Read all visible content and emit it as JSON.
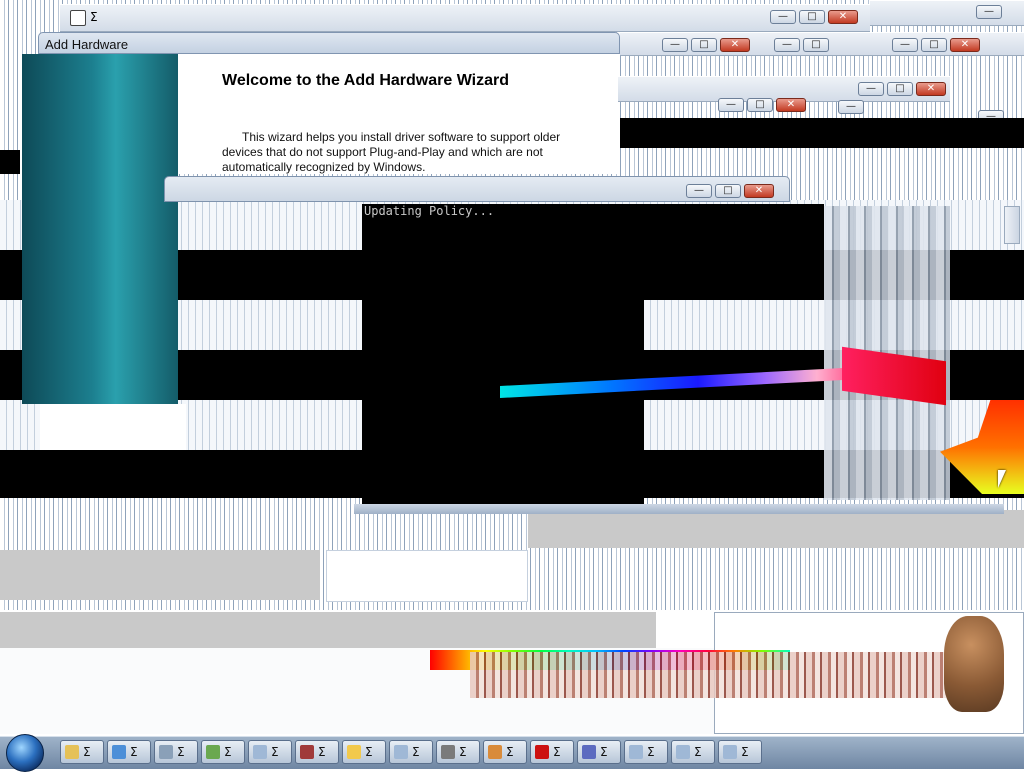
{
  "background_windows": {
    "sigma_label": "Σ"
  },
  "wizard": {
    "title": "Add Hardware",
    "heading": "Welcome to the Add Hardware Wizard",
    "body_line1": "This wizard helps you install driver software to support older",
    "body_line2": "devices that do not support Plug-and-Play and which are not",
    "body_line3": "automatically recognized by Windows."
  },
  "console": {
    "text": "Updating Policy..."
  },
  "window_buttons": {
    "minimize": "—",
    "maximize": "□",
    "close": "✕"
  },
  "taskbar": {
    "items": [
      {
        "label": "Σ",
        "icon": "folder-icon"
      },
      {
        "label": "Σ",
        "icon": "control-panel-icon"
      },
      {
        "label": "Σ",
        "icon": "gears-icon"
      },
      {
        "label": "Σ",
        "icon": "hardware-icon"
      },
      {
        "label": "Σ",
        "icon": "window-icon"
      },
      {
        "label": "Σ",
        "icon": "user-icon"
      },
      {
        "label": "Σ",
        "icon": "x-badge-icon"
      },
      {
        "label": "Σ",
        "icon": "window-icon"
      },
      {
        "label": "Σ",
        "icon": "paint-icon"
      },
      {
        "label": "Σ",
        "icon": "document-icon"
      },
      {
        "label": "Σ",
        "icon": "flash-icon"
      },
      {
        "label": "Σ",
        "icon": "font-icon"
      },
      {
        "label": "Σ",
        "icon": "window-icon"
      },
      {
        "label": "Σ",
        "icon": "window-icon"
      },
      {
        "label": "Σ",
        "icon": "window-icon"
      }
    ]
  },
  "colors": {
    "accent": "#2b6fbf",
    "console_bg": "#000000",
    "close_red": "#c23a22",
    "wizard_teal": "#1c7f8f"
  }
}
